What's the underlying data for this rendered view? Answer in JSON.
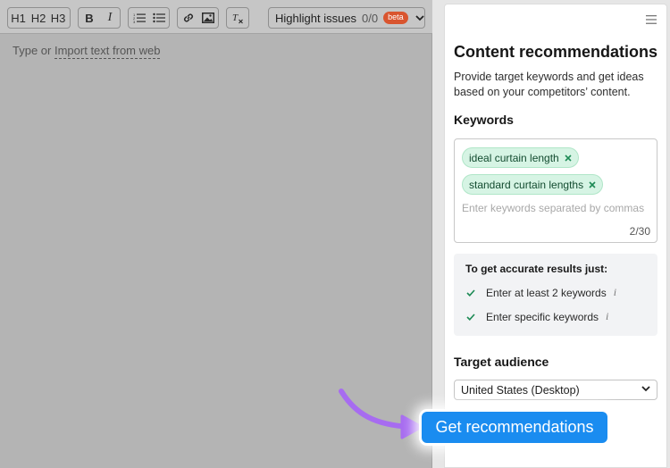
{
  "toolbar": {
    "h1": "H1",
    "h2": "H2",
    "h3": "H3",
    "bold": "B",
    "italic": "I",
    "highlight_label": "Highlight issues",
    "highlight_count": "0/0",
    "beta_badge": "beta",
    "icons": [
      "heading-icon",
      "bold-icon",
      "italic-icon",
      "ordered-list-icon",
      "bullet-list-icon",
      "link-icon",
      "image-icon",
      "clear-format-icon",
      "chevron-down-icon"
    ]
  },
  "editor": {
    "placeholder_prefix": "Type or",
    "import_link": "Import text from web"
  },
  "panel": {
    "title": "Content recommendations",
    "description": "Provide target keywords and get ideas based on your competitors’ content.",
    "keywords_label": "Keywords",
    "keywords": [
      {
        "text": "ideal curtain length"
      },
      {
        "text": "standard curtain lengths"
      }
    ],
    "keyword_placeholder": "Enter keywords separated by commas",
    "keyword_count": "2/30",
    "tips_title": "To get accurate results just:",
    "tips": [
      {
        "text": "Enter at least 2 keywords"
      },
      {
        "text": "Enter specific keywords"
      }
    ],
    "audience_label": "Target audience",
    "audience_value": "United States (Desktop)",
    "cta": "Get recommendations"
  },
  "colors": {
    "cta": "#1a8cf0",
    "chip_bg": "#d6f4e4",
    "chip_text": "#124b2f",
    "check": "#1d8a55",
    "beta": "#d9552f",
    "arrow": "#a76cf0",
    "overlay": "#b4b4b4"
  }
}
